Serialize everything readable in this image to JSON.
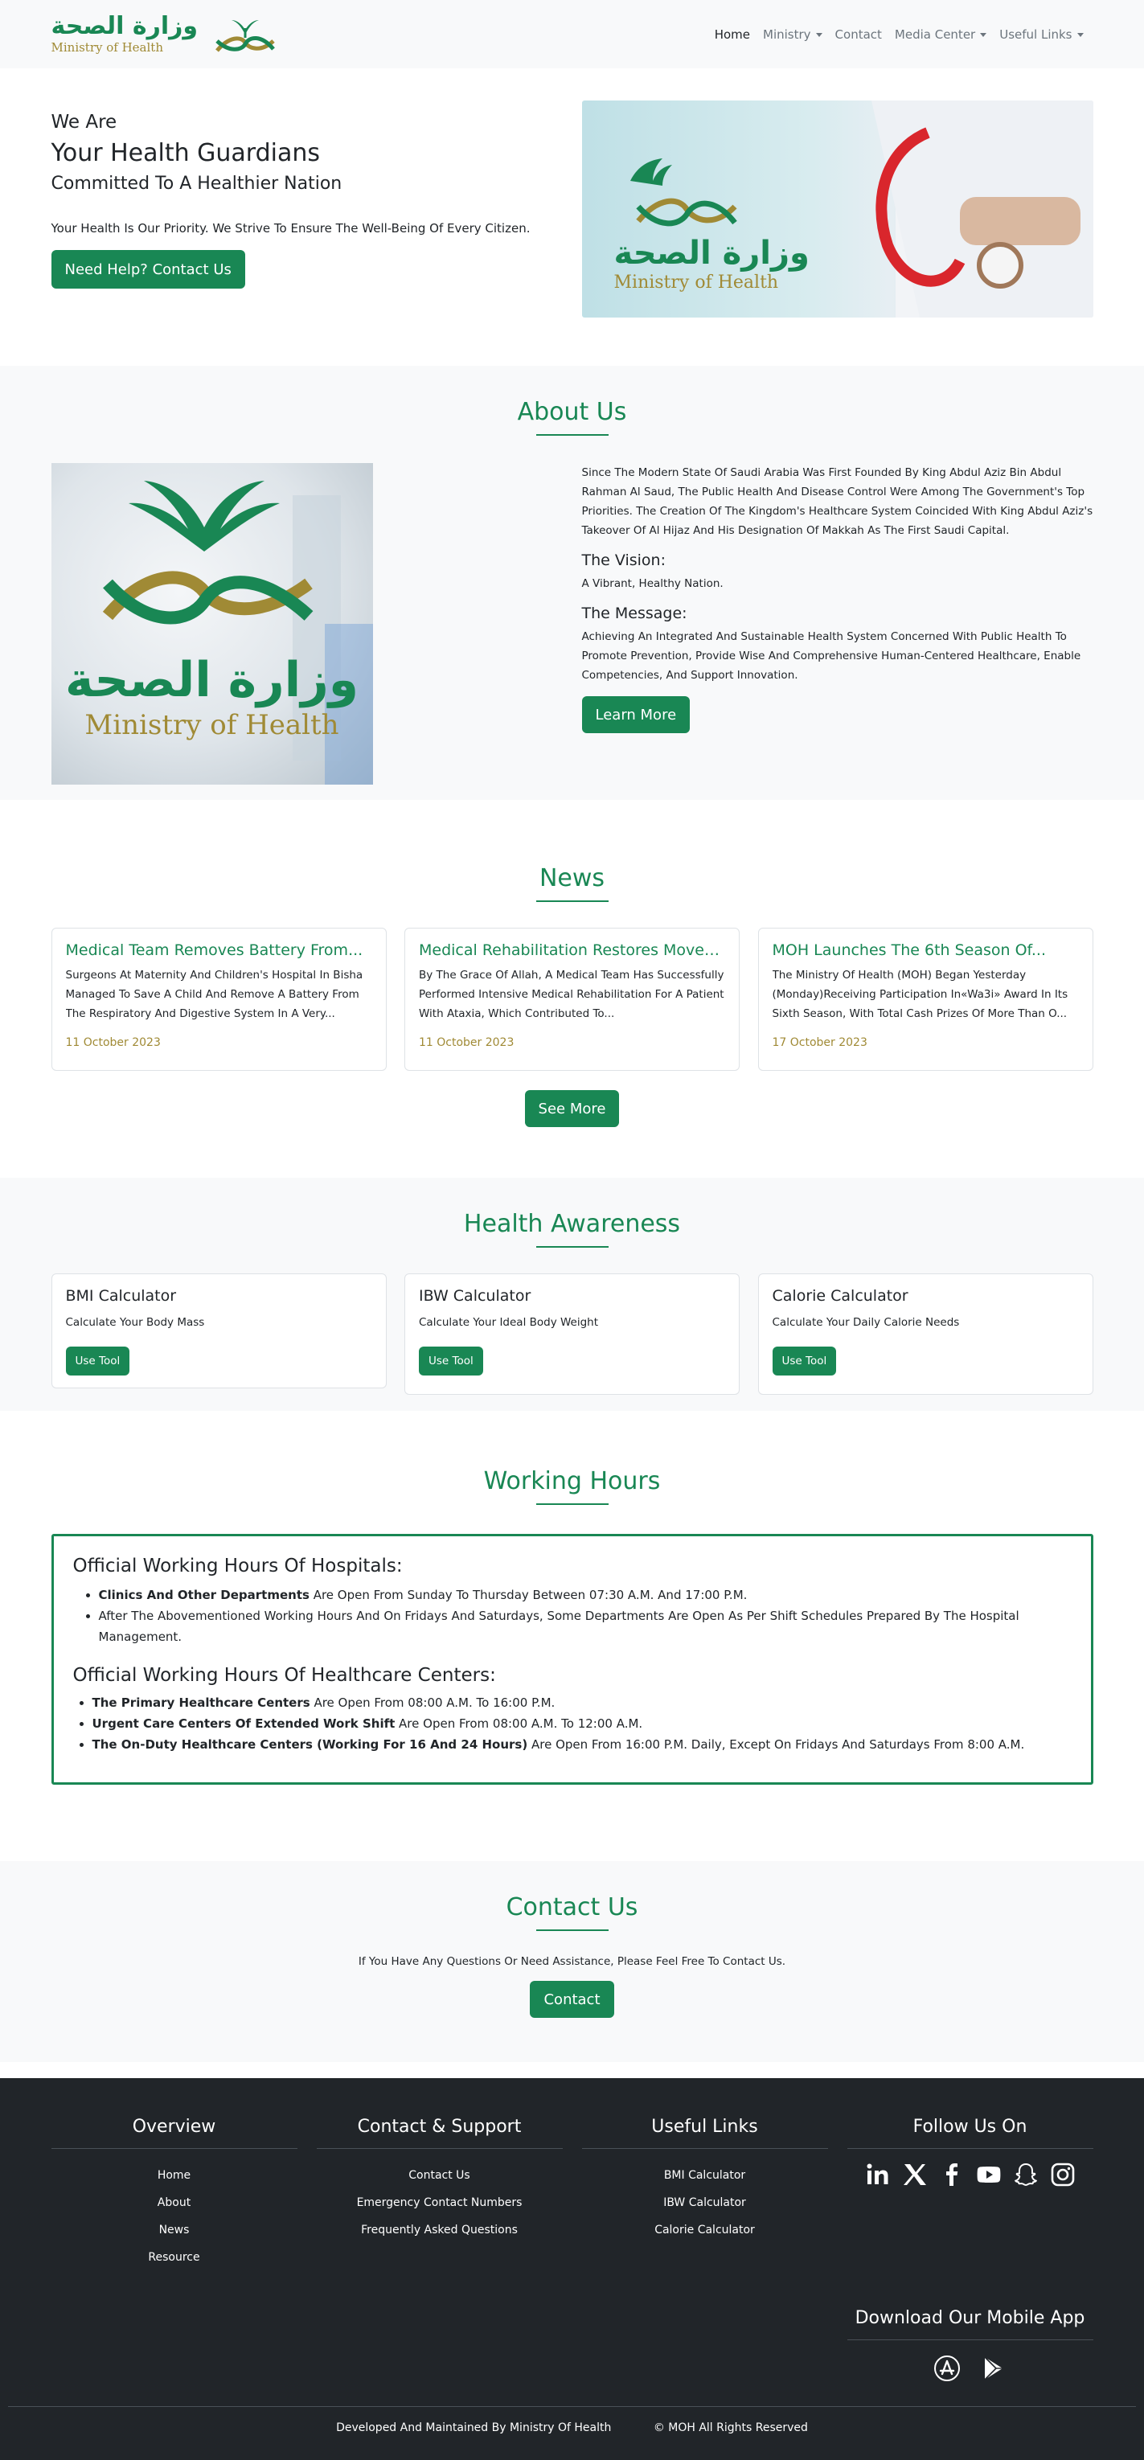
{
  "brand": {
    "arabic": "وزارة الصحة",
    "english": "Ministry of Health"
  },
  "nav": {
    "items": [
      {
        "label": "Home",
        "active": true,
        "dropdown": false
      },
      {
        "label": "Ministry",
        "active": false,
        "dropdown": true
      },
      {
        "label": "Contact",
        "active": false,
        "dropdown": false
      },
      {
        "label": "Media Center",
        "active": false,
        "dropdown": true
      },
      {
        "label": "Useful Links",
        "active": false,
        "dropdown": true
      }
    ]
  },
  "hero": {
    "line1": "We Are",
    "line2": "Your Health Guardians",
    "line3": "Committed To A Healthier Nation",
    "description": "Your Health Is Our Priority. We Strive To Ensure The Well-Being Of Every Citizen.",
    "button": "Need Help? Contact Us",
    "image_logo_ar": "وزارة الصحة",
    "image_logo_en": "Ministry of Health"
  },
  "about": {
    "title": "About Us",
    "text": "Since The Modern State Of Saudi Arabia Was First Founded By King Abdul Aziz Bin Abdul Rahman Al Saud, The Public Health And Disease Control Were Among The Government's Top Priorities. The Creation Of The Kingdom's Healthcare System Coincided With King Abdul Aziz's Takeover Of Al Hijaz And His Designation Of Makkah As The First Saudi Capital.",
    "vision_title": "The Vision:",
    "vision_text": "A Vibrant, Healthy Nation.",
    "message_title": "The Message:",
    "message_text": "Achieving An Integrated And Sustainable Health System Concerned With Public Health To Promote Prevention, Provide Wise And Comprehensive Human-Centered Healthcare, Enable Competencies, And Support Innovation.",
    "button": "Learn More",
    "image_logo_ar": "وزارة الصحة",
    "image_logo_en": "Ministry of Health"
  },
  "news": {
    "title": "News",
    "items": [
      {
        "title": "Medical Team Removes Battery From...",
        "text": "Surgeons At Maternity And Children's Hospital In Bisha Managed To Save A Child And Remove A Battery From The Respiratory And Digestive System In A Very...",
        "date": "11 October 2023"
      },
      {
        "title": "Medical Rehabilitation Restores Moveme...",
        "text": "By The Grace Of Allah, A Medical Team Has Successfully Performed Intensive Medical Rehabilitation For A Patient With Ataxia, Which Contributed To...",
        "date": "11 October 2023"
      },
      {
        "title": "MOH Launches The 6th Season Of...",
        "text": "The Ministry Of Health (MOH) Began Yesterday (Monday)Receiving Participation In«Wa3i» Award In Its Sixth Season, With Total Cash Prizes Of More Than O...",
        "date": "17 October 2023"
      }
    ],
    "button": "See More"
  },
  "awareness": {
    "title": "Health Awareness",
    "items": [
      {
        "title": "BMI Calculator",
        "text": "Calculate Your Body Mass",
        "button": "Use Tool"
      },
      {
        "title": "IBW Calculator",
        "text": "Calculate Your Ideal Body Weight",
        "button": "Use Tool"
      },
      {
        "title": "Calorie Calculator",
        "text": "Calculate Your Daily Calorie Needs",
        "button": "Use Tool"
      }
    ]
  },
  "hours": {
    "title": "Working Hours",
    "hospitals_title": "Official Working Hours Of Hospitals:",
    "hospitals": [
      {
        "bold": "Clinics And Other Departments",
        "rest": " Are Open From Sunday To Thursday Between 07:30 A.M. And 17:00 P.M."
      },
      {
        "bold": "",
        "rest": "After The Abovementioned Working Hours And On Fridays And Saturdays, Some Departments Are Open As Per Shift Schedules Prepared By The Hospital Management."
      }
    ],
    "centers_title": "Official Working Hours Of Healthcare Centers:",
    "centers": [
      {
        "bold": "The Primary Healthcare Centers",
        "rest": " Are Open From 08:00 A.M. To 16:00 P.M."
      },
      {
        "bold": "Urgent Care Centers Of Extended Work Shift",
        "rest": " Are Open From 08:00 A.M. To 12:00 A.M."
      },
      {
        "bold": "The On-Duty Healthcare Centers (Working For 16 And 24 Hours)",
        "rest": " Are Open From 16:00 P.M. Daily, Except On Fridays And Saturdays From 8:00 A.M."
      }
    ]
  },
  "contact": {
    "title": "Contact Us",
    "text": "If You Have Any Questions Or Need Assistance, Please Feel Free To Contact Us.",
    "button": "Contact"
  },
  "footer": {
    "overview": {
      "title": "Overview",
      "links": [
        "Home",
        "About",
        "News",
        "Resource"
      ]
    },
    "support": {
      "title": "Contact & Support",
      "links": [
        "Contact Us",
        "Emergency Contact Numbers",
        "Frequently Asked Questions"
      ]
    },
    "useful": {
      "title": "Useful Links",
      "links": [
        "BMI Calculator",
        "IBW Calculator",
        "Calorie Calculator"
      ]
    },
    "follow": {
      "title": "Follow Us On",
      "icons": [
        "linkedin-icon",
        "x-icon",
        "facebook-icon",
        "youtube-icon",
        "snapchat-icon",
        "instagram-icon"
      ]
    },
    "app": {
      "title": "Download Our Mobile App",
      "icons": [
        "app-store-icon",
        "google-play-icon"
      ]
    },
    "bottom_left": "Developed And Maintained By Ministry Of Health",
    "bottom_right": "© MOH All Rights Reserved"
  },
  "colors": {
    "primary": "#198754",
    "gold": "#a08a35",
    "footer": "#212529",
    "light": "#f8f9fa"
  }
}
